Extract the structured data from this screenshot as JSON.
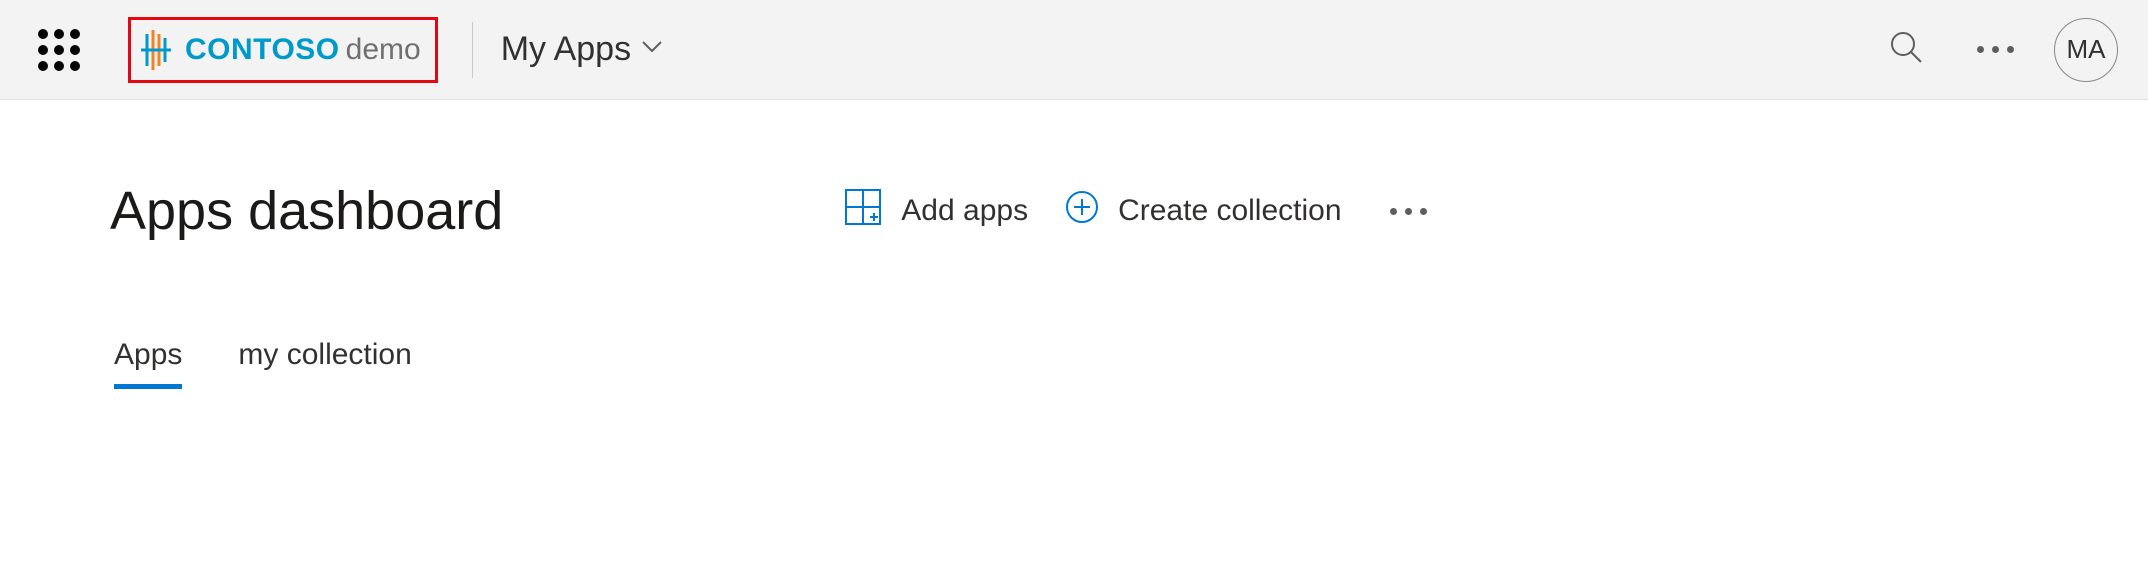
{
  "header": {
    "brand_name": "CONTOSO",
    "brand_suffix": "demo",
    "app_switcher_label": "My Apps",
    "avatar_initials": "MA"
  },
  "page": {
    "title": "Apps dashboard",
    "actions": {
      "add_apps": "Add apps",
      "create_collection": "Create collection"
    },
    "tabs": [
      {
        "label": "Apps",
        "active": true
      },
      {
        "label": "my collection",
        "active": false
      }
    ]
  }
}
